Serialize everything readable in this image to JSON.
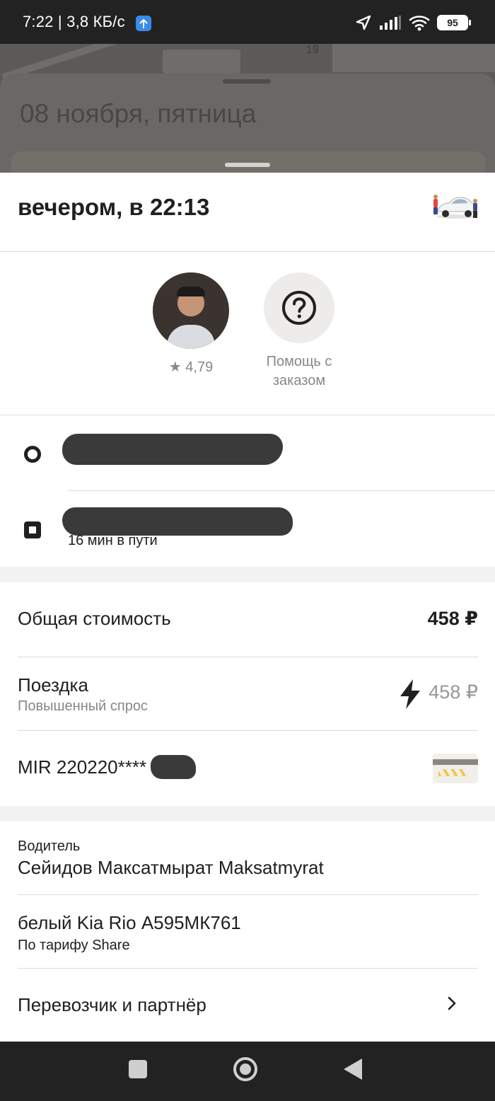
{
  "status_bar": {
    "time": "7:22 | 3,8 КБ/с",
    "battery": "95",
    "upload_icon": "upload-arrow-icon",
    "icons": [
      "location-arrow-icon",
      "signal-icon",
      "wifi-icon",
      "battery-icon"
    ]
  },
  "background": {
    "date": "08 ноября, пятница",
    "map_label": "19"
  },
  "header": {
    "title": "вечером, в 22:13",
    "illustration": "car-with-people-icon"
  },
  "contacts": {
    "driver_rating": "★ 4,79",
    "help_label": "Помощь с заказом"
  },
  "route": {
    "eta": "16 мин в пути"
  },
  "cost": {
    "total_label": "Общая стоимость",
    "total_value": "458 ₽",
    "ride_label": "Поездка",
    "ride_sub": "Повышенный спрос",
    "ride_value": "458 ₽",
    "card_label": "MIR 220220****"
  },
  "info": {
    "driver_caption": "Водитель",
    "driver_name": "Сейидов Максатмырат Maksatmyrat",
    "car": "белый Kia Rio А595МК761",
    "tariff": "По тарифу Share",
    "carrier_label": "Перевозчик и партнёр"
  },
  "colors": {
    "accent_dark": "#21201f",
    "muted_text": "#8a8784",
    "divider": "#dddbd7"
  }
}
